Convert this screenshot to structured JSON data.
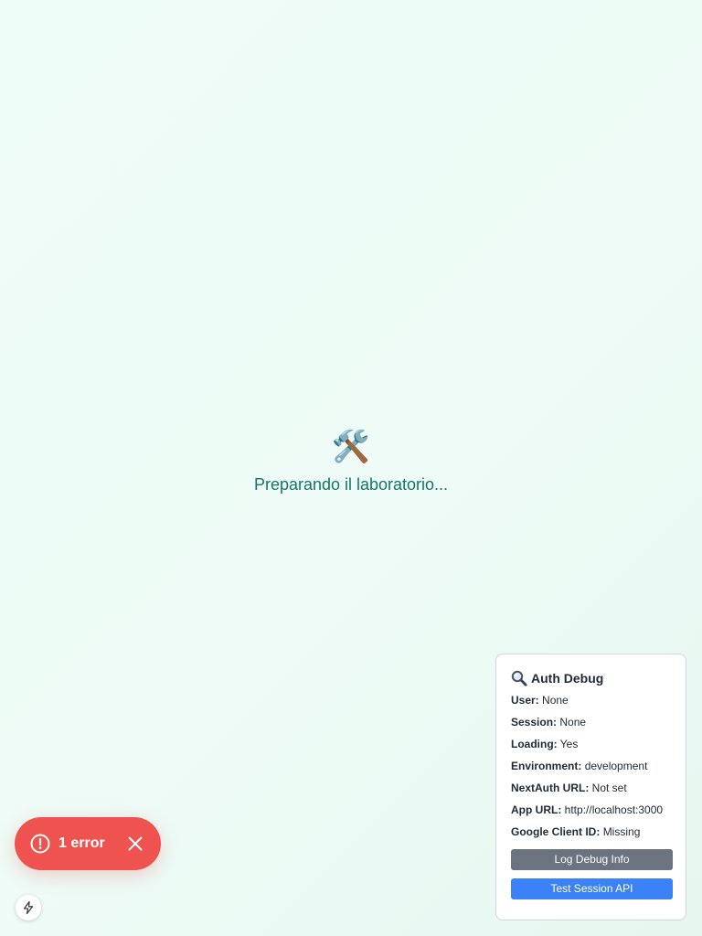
{
  "loading": {
    "emoji": "🛠️",
    "text": "Preparando il laboratorio..."
  },
  "debug": {
    "icon": "magnifying-glass-icon",
    "title": "Auth Debug",
    "rows": [
      {
        "label": "User:",
        "value": "None"
      },
      {
        "label": "Session:",
        "value": "None"
      },
      {
        "label": "Loading:",
        "value": "Yes"
      },
      {
        "label": "Environment:",
        "value": "development"
      },
      {
        "label": "NextAuth URL:",
        "value": "Not set"
      },
      {
        "label": "App URL:",
        "value": "http://localhost:3000"
      },
      {
        "label": "Google Client ID:",
        "value": "Missing"
      }
    ],
    "log_button": "Log Debug Info",
    "test_button": "Test Session API",
    "colors": {
      "log_button_bg": "#6b7280",
      "test_button_bg": "#3b82f6"
    }
  },
  "error_toast": {
    "label": "1 error",
    "icon": "alert-circle-icon",
    "close_icon": "close-icon",
    "color": "#ef5350"
  },
  "next_badge": {
    "icon": "lightning-bolt-icon"
  },
  "colors": {
    "accent_text": "#127766",
    "background": "#effdf8"
  }
}
